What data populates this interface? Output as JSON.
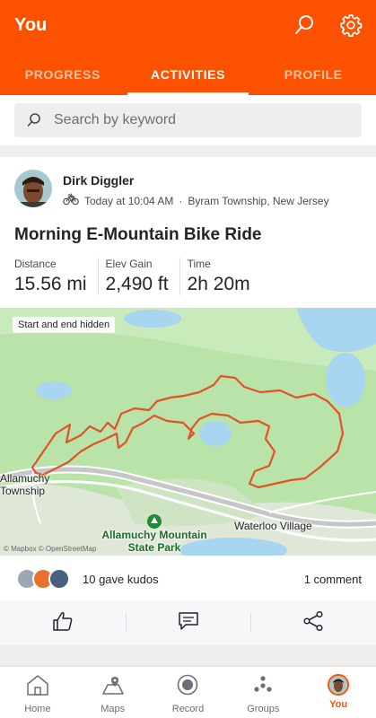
{
  "header": {
    "title": "You"
  },
  "tabs": [
    "PROGRESS",
    "ACTIVITIES",
    "PROFILE"
  ],
  "search": {
    "placeholder": "Search by keyword"
  },
  "activity": {
    "athlete": "Dirk Diggler",
    "when": "Today at 10:04 AM",
    "location": "Byram Township, New Jersey",
    "title": "Morning E-Mountain Bike Ride",
    "stats": [
      {
        "label": "Distance",
        "value": "15.56 mi"
      },
      {
        "label": "Elev Gain",
        "value": "2,490 ft"
      },
      {
        "label": "Time",
        "value": "2h 20m"
      }
    ],
    "map": {
      "badge": "Start and end hidden",
      "town_line1": "Allamuchy",
      "town_line2": "Township",
      "park_line1": "Allamuchy Mountain",
      "park_line2": "State Park",
      "village": "Waterloo Village",
      "attribution": "© Mapbox © OpenStreetMap"
    },
    "kudos": "10 gave kudos",
    "comments": "1 comment"
  },
  "nav": [
    "Home",
    "Maps",
    "Record",
    "Groups",
    "You"
  ],
  "colors": {
    "brand": "#fc5200",
    "route": "#e0522a",
    "map_green": "#b9e3a9"
  }
}
